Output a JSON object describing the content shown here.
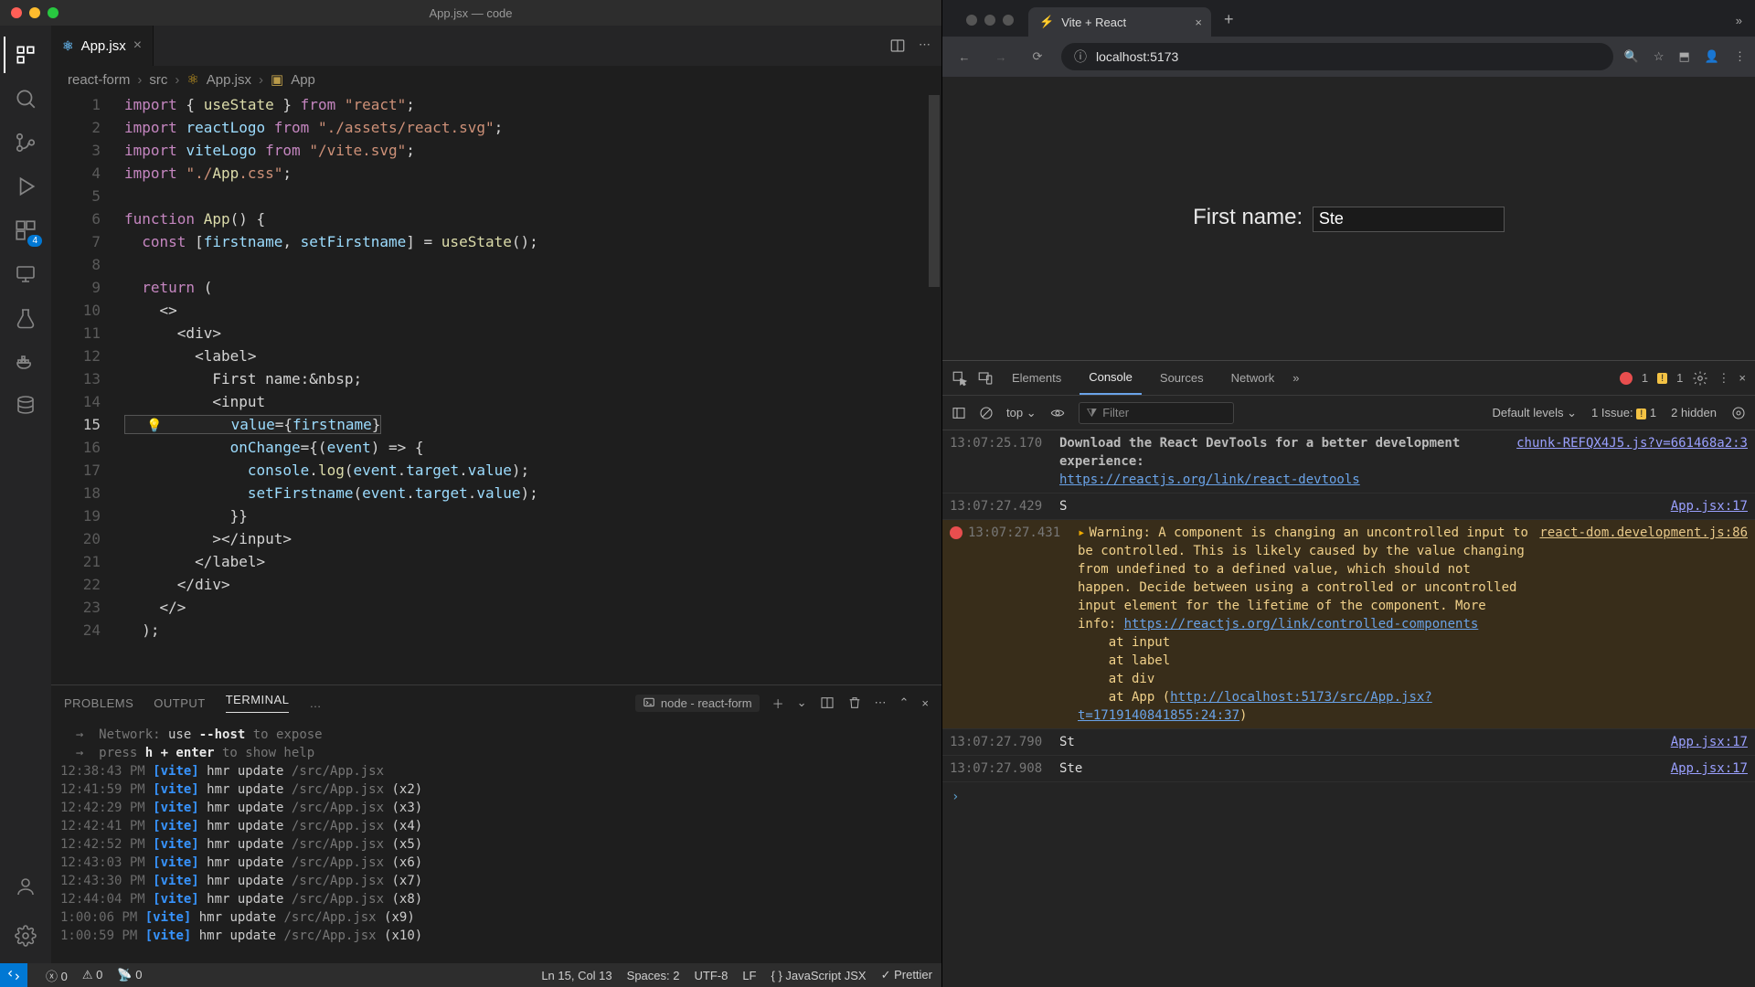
{
  "vscode": {
    "title": "App.jsx — code",
    "tab": {
      "filename": "App.jsx"
    },
    "breadcrumbs": [
      "react-form",
      "src",
      "App.jsx",
      "App"
    ],
    "activity_badge": "4",
    "code": {
      "lines": [
        "import { useState } from \"react\";",
        "import reactLogo from \"./assets/react.svg\";",
        "import viteLogo from \"/vite.svg\";",
        "import \"./App.css\";",
        "",
        "function App() {",
        "  const [firstname, setFirstname] = useState();",
        "",
        "  return (",
        "    <>",
        "      <div>",
        "        <label>",
        "          First name:&nbsp;",
        "          <input",
        "            value={firstname}",
        "            onChange={(event) => {",
        "              console.log(event.target.value);",
        "              setFirstname(event.target.value);",
        "            }}",
        "          ></input>",
        "        </label>",
        "      </div>",
        "    </>",
        "  );"
      ]
    },
    "panel": {
      "tabs": [
        "PROBLEMS",
        "OUTPUT",
        "TERMINAL",
        "…"
      ],
      "active": "TERMINAL",
      "task": "node - react-form",
      "terminal_lines": [
        {
          "pre": "  →  ",
          "dimLabel": "Network:",
          "rest": " use ",
          "bold": "--host",
          "rest2": " to expose"
        },
        {
          "pre": "  →  ",
          "dimLabel": "press ",
          "bold": "h + enter",
          "rest2": " to show help"
        }
      ],
      "hmr": [
        {
          "t": "12:38:43 PM",
          "file": "/src/App.jsx",
          "n": ""
        },
        {
          "t": "12:41:59 PM",
          "file": "/src/App.jsx",
          "n": "(x2)"
        },
        {
          "t": "12:42:29 PM",
          "file": "/src/App.jsx",
          "n": "(x3)"
        },
        {
          "t": "12:42:41 PM",
          "file": "/src/App.jsx",
          "n": "(x4)"
        },
        {
          "t": "12:42:52 PM",
          "file": "/src/App.jsx",
          "n": "(x5)"
        },
        {
          "t": "12:43:03 PM",
          "file": "/src/App.jsx",
          "n": "(x6)"
        },
        {
          "t": "12:43:30 PM",
          "file": "/src/App.jsx",
          "n": "(x7)"
        },
        {
          "t": "12:44:04 PM",
          "file": "/src/App.jsx",
          "n": "(x8)"
        },
        {
          "t": "1:00:06 PM",
          "file": "/src/App.jsx",
          "n": "(x9)"
        },
        {
          "t": "1:00:59 PM",
          "file": "/src/App.jsx",
          "n": "(x10)"
        }
      ]
    },
    "status": {
      "errors": "0",
      "warnings": "0",
      "ports": "0",
      "lncol": "Ln 15, Col 13",
      "spaces": "Spaces: 2",
      "encoding": "UTF-8",
      "eol": "LF",
      "lang": "JavaScript JSX",
      "prettier": "Prettier"
    }
  },
  "browser": {
    "tab_title": "Vite + React",
    "url": "localhost:5173",
    "page": {
      "label": "First name:",
      "value": "Ste"
    },
    "devtools": {
      "tabs": [
        "Elements",
        "Console",
        "Sources",
        "Network"
      ],
      "active": "Console",
      "errorCount": "1",
      "warnCount": "1",
      "filter_placeholder": "Filter",
      "scope": "top",
      "levels": "Default levels",
      "issues": "1 Issue:",
      "issuesBadge": "1",
      "hidden": "2 hidden",
      "rows": [
        {
          "type": "info",
          "ts": "13:07:25.170",
          "msg1": "Download the React DevTools for a better development experience:",
          "link1": "https://reactjs.org/link/react-devtools",
          "src": "chunk-REFQX4J5.js?v=661468a2:3"
        },
        {
          "type": "log",
          "ts": "13:07:27.429",
          "msg": "S",
          "src": "App.jsx:17"
        },
        {
          "type": "warn",
          "ts": "13:07:27.431",
          "head": "Warning: A component is changing an uncontrolled input to be controlled. This is likely caused by the value changing from undefined to a defined value, which should not happen. Decide between using a controlled or uncontrolled input element for the lifetime of the component. More info:",
          "link": "https://reactjs.org/link/controlled-components",
          "stack": [
            "at input",
            "at label",
            "at div"
          ],
          "stackApp": "at App (",
          "stackAppLink": "http://localhost:5173/src/App.jsx?t=1719140841855:24:37",
          "src": "react-dom.development.js:86"
        },
        {
          "type": "log",
          "ts": "13:07:27.790",
          "msg": "St",
          "src": "App.jsx:17"
        },
        {
          "type": "log",
          "ts": "13:07:27.908",
          "msg": "Ste",
          "src": "App.jsx:17"
        }
      ]
    }
  }
}
